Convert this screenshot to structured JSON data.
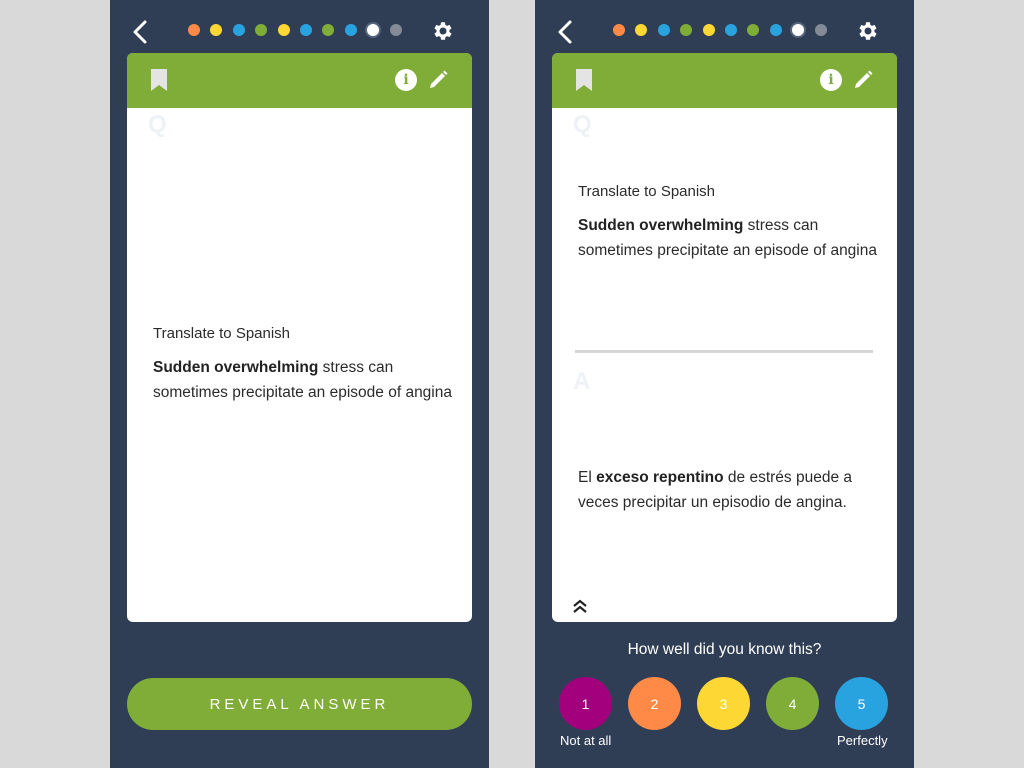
{
  "progress_dots": [
    {
      "color": "#ff8a47",
      "state": "done"
    },
    {
      "color": "#fdd835",
      "state": "done"
    },
    {
      "color": "#29a3e0",
      "state": "done"
    },
    {
      "color": "#80ad38",
      "state": "done"
    },
    {
      "color": "#fdd835",
      "state": "done"
    },
    {
      "color": "#29a3e0",
      "state": "done"
    },
    {
      "color": "#80ad38",
      "state": "done"
    },
    {
      "color": "#29a3e0",
      "state": "done"
    },
    {
      "color": "#ffffff",
      "state": "current"
    },
    {
      "color": "#858b96",
      "state": "upcoming"
    }
  ],
  "icons": {
    "back": "chevron-left-icon",
    "settings": "gear-icon",
    "bookmark": "bookmark-icon",
    "info": "info-icon",
    "edit": "pencil-icon",
    "collapse": "double-chevron-up-icon"
  },
  "colors": {
    "background": "#d9d9d9",
    "panel": "#2f3e55",
    "accent": "#80ad38"
  },
  "question_view": {
    "question_marker": "Q",
    "prompt_label": "Translate to Spanish",
    "prompt_bold": "Sudden overwhelming",
    "prompt_rest": " stress can sometimes precipitate an episode of angina",
    "reveal_button": "REVEAL ANSWER"
  },
  "answer_view": {
    "question_marker": "Q",
    "prompt_label": "Translate to Spanish",
    "prompt_bold": "Sudden overwhelming",
    "prompt_rest": " stress can sometimes precipitate an episode of angina",
    "answer_marker": "A",
    "answer_prefix": "El ",
    "answer_bold": "exceso repentino",
    "answer_rest": " de estrés puede a veces precipitar un episodio de angina.",
    "rating_question": "How well did you know this?",
    "rating_options": [
      {
        "label": "1",
        "color": "#a3007e"
      },
      {
        "label": "2",
        "color": "#ff8a47"
      },
      {
        "label": "3",
        "color": "#fdd835"
      },
      {
        "label": "4",
        "color": "#80ad38"
      },
      {
        "label": "5",
        "color": "#29a3e0"
      }
    ],
    "rating_min_caption": "Not at all",
    "rating_max_caption": "Perfectly"
  }
}
